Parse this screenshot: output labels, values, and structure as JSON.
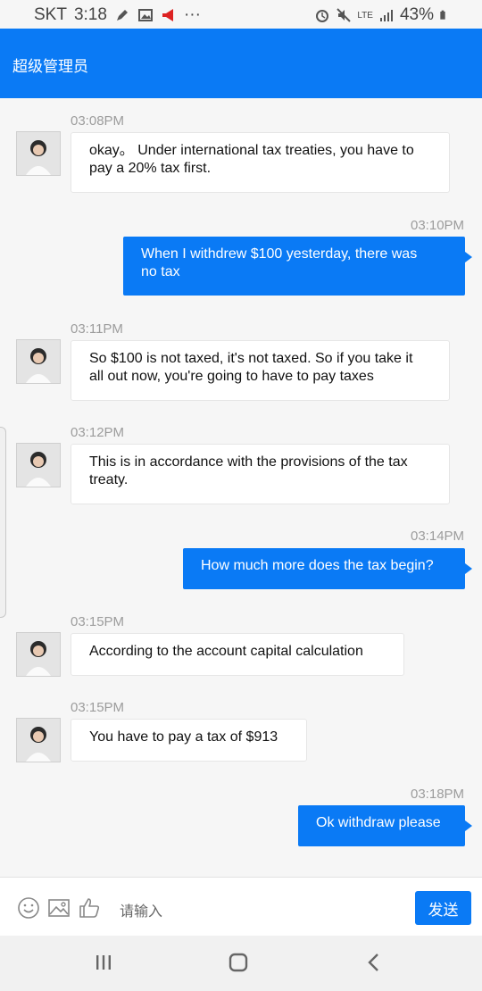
{
  "status_bar": {
    "carrier": "SKT",
    "time": "3:18",
    "more": "···",
    "network": "LTE",
    "battery": "43%"
  },
  "header": {
    "title": "超级管理员"
  },
  "messages": [
    {
      "direction": "in",
      "time": "03:08PM",
      "lines": [
        "okay。 Under international tax treaties, you have to",
        "pay a 20% tax first."
      ]
    },
    {
      "direction": "out",
      "time": "03:10PM",
      "lines": [
        "When I withdrew $100 yesterday, there was",
        "no tax"
      ]
    },
    {
      "direction": "in",
      "time": "03:11PM",
      "lines": [
        "So $100 is not taxed, it's not taxed. So if you take it",
        "all out now, you're going to have to pay taxes"
      ]
    },
    {
      "direction": "in",
      "time": "03:12PM",
      "lines": [
        "This is in accordance with the provisions of the tax",
        "treaty."
      ]
    },
    {
      "direction": "out",
      "time": "03:14PM",
      "lines": [
        "How much more does the tax begin?"
      ]
    },
    {
      "direction": "in",
      "time": "03:15PM",
      "lines": [
        "According to the account capital calculation"
      ]
    },
    {
      "direction": "in",
      "time": "03:15PM",
      "lines": [
        "You have to pay a tax of $913"
      ]
    },
    {
      "direction": "out",
      "time": "03:18PM",
      "lines": [
        "Ok withdraw please"
      ]
    }
  ],
  "input_bar": {
    "placeholder": "请输入",
    "send_label": "发送",
    "icons": [
      "emoji-icon",
      "image-icon",
      "thumbs-up-icon"
    ]
  },
  "nav_bar": {
    "icons": [
      "recent-apps-icon",
      "home-icon",
      "back-icon"
    ]
  },
  "colors": {
    "accent": "#0a7af5",
    "background": "#f6f6f6",
    "bubble_in": "#ffffff"
  }
}
